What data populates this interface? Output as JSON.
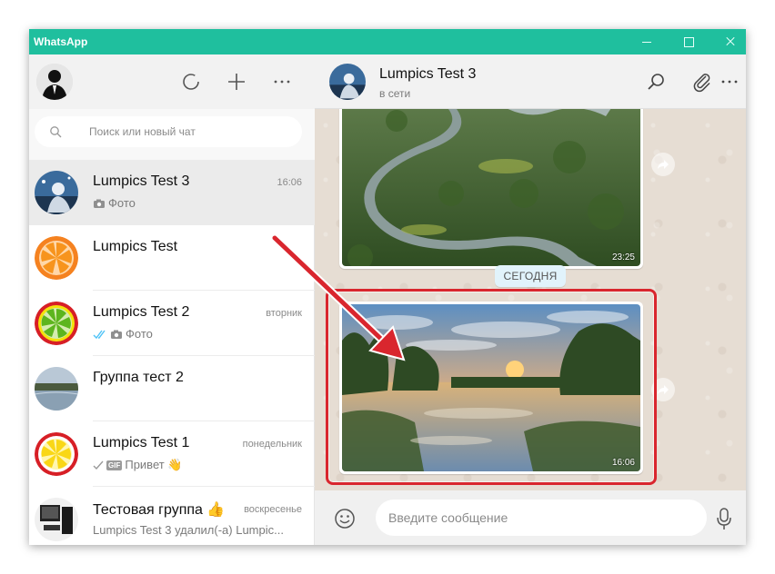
{
  "window": {
    "title": "WhatsApp"
  },
  "sidebar": {
    "search_placeholder": "Поиск или новый чат",
    "chats": [
      {
        "name": "Lumpics Test 3",
        "time": "16:06",
        "preview": "Фото",
        "preview_icon": "camera-icon"
      },
      {
        "name": "Lumpics Test",
        "time": "",
        "preview": ""
      },
      {
        "name": "Lumpics Test 2",
        "time": "вторник",
        "preview": "Фото",
        "preview_icon": "double-check-camera-icon"
      },
      {
        "name": "Группа тест 2",
        "time": "",
        "preview": ""
      },
      {
        "name": "Lumpics Test 1",
        "time": "понедельник",
        "preview": "Привет 👋",
        "preview_badge": "GIF"
      },
      {
        "name": "Тестовая группа 👍",
        "time": "воскресенье",
        "preview": "Lumpics Test 3 удалил(-а) Lumpic..."
      }
    ]
  },
  "chat": {
    "name": "Lumpics Test 3",
    "status": "в сети",
    "messages": [
      {
        "type": "photo",
        "time": "23:25"
      },
      {
        "type": "date",
        "label": "СЕГОДНЯ"
      },
      {
        "type": "photo",
        "time": "16:06"
      }
    ],
    "composer_placeholder": "Введите сообщение"
  },
  "colors": {
    "titlebar": "#1fbf9e",
    "highlight": "#d9262e",
    "chat_bg": "#e6ddd3"
  }
}
